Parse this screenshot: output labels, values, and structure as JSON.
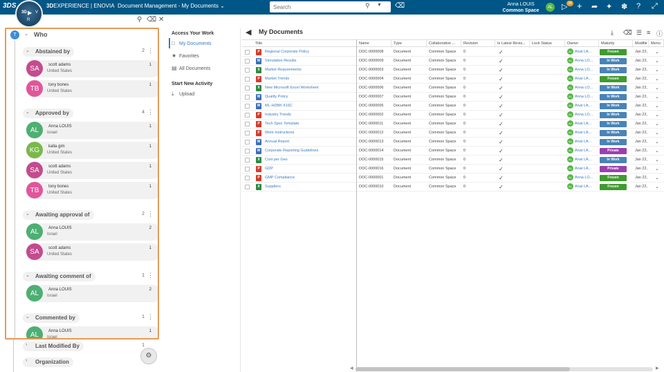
{
  "topbar": {
    "ds_logo": "3DS",
    "compass": {
      "label_3d": "3D",
      "label_v": "V",
      "label_r": "R",
      "label_play": "▶"
    },
    "brand_bold": "3D",
    "brand_rest": "EXPERIENCE | ENOVIA",
    "app_title": "Document Management - My Documents",
    "title_chevron": "⌄",
    "search_placeholder": "Search",
    "user_name": "Anna LOUIS",
    "user_space": "Common Space",
    "user_initials": "AL",
    "notification_count": "34"
  },
  "filter_panel": {
    "title": "Who",
    "title_initial": "T",
    "groups": [
      {
        "label": "Abstained by",
        "count": "2",
        "people": [
          {
            "initials": "SA",
            "name": "scott adams",
            "location": "United States",
            "count": "1",
            "color": "#c44b8e"
          },
          {
            "initials": "TB",
            "name": "tony bones",
            "location": "United States",
            "count": "1",
            "color": "#e2559b"
          }
        ]
      },
      {
        "label": "Approved by",
        "count": "4",
        "people": [
          {
            "initials": "AL",
            "name": "Anna LOUIS",
            "location": "Israel",
            "count": "1",
            "color": "#4caf73"
          },
          {
            "initials": "KG",
            "name": "kalla gim",
            "location": "United States",
            "count": "1",
            "color": "#79b84a"
          },
          {
            "initials": "SA",
            "name": "scott adams",
            "location": "United States",
            "count": "1",
            "color": "#c44b8e"
          },
          {
            "initials": "TB",
            "name": "tony bones",
            "location": "United States",
            "count": "1",
            "color": "#e2559b"
          }
        ]
      },
      {
        "label": "Awaiting approval of",
        "count": "2",
        "people": [
          {
            "initials": "AL",
            "name": "Anna LOUIS",
            "location": "Israel",
            "count": "2",
            "color": "#4caf73"
          },
          {
            "initials": "SA",
            "name": "scott adams",
            "location": "United States",
            "count": "1",
            "color": "#c44b8e"
          }
        ]
      },
      {
        "label": "Awaiting comment of",
        "count": "1",
        "people": [
          {
            "initials": "AL",
            "name": "Anna LOUIS",
            "location": "Israel",
            "count": "2",
            "color": "#4caf73"
          }
        ]
      },
      {
        "label": "Commented by",
        "count": "1",
        "people": [
          {
            "initials": "AL",
            "name": "Anna LOUIS",
            "location": "Israel",
            "count": "1",
            "color": "#4caf73"
          }
        ]
      }
    ],
    "collapsed_groups": [
      {
        "label": "Last Modified By",
        "count": "1"
      },
      {
        "label": "Organization",
        "count": ""
      }
    ]
  },
  "nav": {
    "access_heading": "Access Your Work",
    "items": [
      "My Documents",
      "Favorites",
      "All Documents"
    ],
    "start_heading": "Start New Activity",
    "upload": "Upload"
  },
  "main": {
    "title": "My Documents",
    "columns": [
      "Title",
      "Name",
      "Type",
      "Collaborative ...",
      "Revision",
      "Is Latest Revis...",
      "Lock Status",
      "Owner",
      "Maturity",
      "Modifie",
      "Menu"
    ],
    "rows": [
      {
        "title": "Regional Corporate Policy",
        "name": "DOC-0000008",
        "type": "Document",
        "space": "Common Space",
        "rev": "0",
        "owner": "Anat LA...",
        "maturity": "Frozen",
        "modified": "Jan 22,",
        "icon": "pdf"
      },
      {
        "title": "Simulation Results",
        "name": "DOC-0000009",
        "type": "Document",
        "space": "Common Space",
        "rev": "0",
        "owner": "Anna LO...",
        "maturity": "In Work",
        "modified": "Jan 22,",
        "icon": "doc"
      },
      {
        "title": "Market Requirements",
        "name": "DOC-0000003",
        "type": "Document",
        "space": "Common Space",
        "rev": "0",
        "owner": "Anna LO...",
        "maturity": "In Work",
        "modified": "Jan 22,",
        "icon": "xls"
      },
      {
        "title": "Market Trends",
        "name": "DOC-0000004",
        "type": "Document",
        "space": "Common Space",
        "rev": "0",
        "owner": "Anat LA...",
        "maturity": "Frozen",
        "modified": "Jan 22,",
        "icon": "pdf"
      },
      {
        "title": "New Microsoft Excel Worksheet",
        "name": "DOC-0000006",
        "type": "Document",
        "space": "Common Space",
        "rev": "0",
        "owner": "Anna LO...",
        "maturity": "In Work",
        "modified": "Jan 22,",
        "icon": "xls"
      },
      {
        "title": "Quality Policy",
        "name": "DOC-0000007",
        "type": "Document",
        "space": "Common Space",
        "rev": "0",
        "owner": "Anna LO...",
        "maturity": "In Work",
        "modified": "Jan 22,",
        "icon": "doc"
      },
      {
        "title": "ML-HDBK-516C",
        "name": "DOC-0000005",
        "type": "Document",
        "space": "Common Space",
        "rev": "0",
        "owner": "Anat LA...",
        "maturity": "In Work",
        "modified": "Jan 22,",
        "icon": "doc"
      },
      {
        "title": "Industry Trends",
        "name": "DOC-0000002",
        "type": "Document",
        "space": "Common Space",
        "rev": "0",
        "owner": "Anna LO...",
        "maturity": "In Work",
        "modified": "Jan 22,",
        "icon": "pdf"
      },
      {
        "title": "Tech Spec Template",
        "name": "DOC-0000011",
        "type": "Document",
        "space": "Common Space",
        "rev": "0",
        "owner": "Anat LA...",
        "maturity": "In Work",
        "modified": "Jan 22,",
        "icon": "pdf"
      },
      {
        "title": "Work Instructions",
        "name": "DOC-0000012",
        "type": "Document",
        "space": "Common Space",
        "rev": "0",
        "owner": "Anat LA...",
        "maturity": "In Work",
        "modified": "Jan 22,",
        "icon": "pdf"
      },
      {
        "title": "Annual Report",
        "name": "DOC-0000013",
        "type": "Document",
        "space": "Common Space",
        "rev": "0",
        "owner": "Anat LA...",
        "maturity": "In Work",
        "modified": "Jan 22,",
        "icon": "doc"
      },
      {
        "title": "Corporate Reporting Guidelines",
        "name": "DOC-0000014",
        "type": "Document",
        "space": "Common Space",
        "rev": "0",
        "owner": "Anat LA...",
        "maturity": "Private",
        "modified": "Jan 22,",
        "icon": "doc"
      },
      {
        "title": "Cost per Geo",
        "name": "DOC-0000015",
        "type": "Document",
        "space": "Common Space",
        "rev": "0",
        "owner": "Anat LA...",
        "maturity": "In Work",
        "modified": "Jan 22,",
        "icon": "xls"
      },
      {
        "title": "GDP",
        "name": "DOC-0000016",
        "type": "Document",
        "space": "Common Space",
        "rev": "0",
        "owner": "Anat LA...",
        "maturity": "Private",
        "modified": "Jan 22,",
        "icon": "pdf"
      },
      {
        "title": "GMP Compliance",
        "name": "DOC-0000001",
        "type": "Document",
        "space": "Common Space",
        "rev": "0",
        "owner": "Anna LO...",
        "maturity": "Frozen",
        "modified": "Jan 22,",
        "icon": "pdf"
      },
      {
        "title": "Suppliers",
        "name": "DOC-0000010",
        "type": "Document",
        "space": "Common Space",
        "rev": "0",
        "owner": "Anat LA...",
        "maturity": "Frozen",
        "modified": "Jan 22,",
        "icon": "xls"
      }
    ],
    "maturity_colors": {
      "Frozen": "#3f9b2f",
      "In Work": "#4784b8",
      "Private": "#9b3fb0"
    },
    "icon_colors": {
      "pdf": "#d33a2c",
      "doc": "#3b6fb6",
      "xls": "#2f8a43"
    },
    "icon_letters": {
      "pdf": "P",
      "doc": "W",
      "xls": "X"
    },
    "owner_initials": "AL",
    "checkmark": "✓",
    "menu_chevron": "⌄"
  }
}
